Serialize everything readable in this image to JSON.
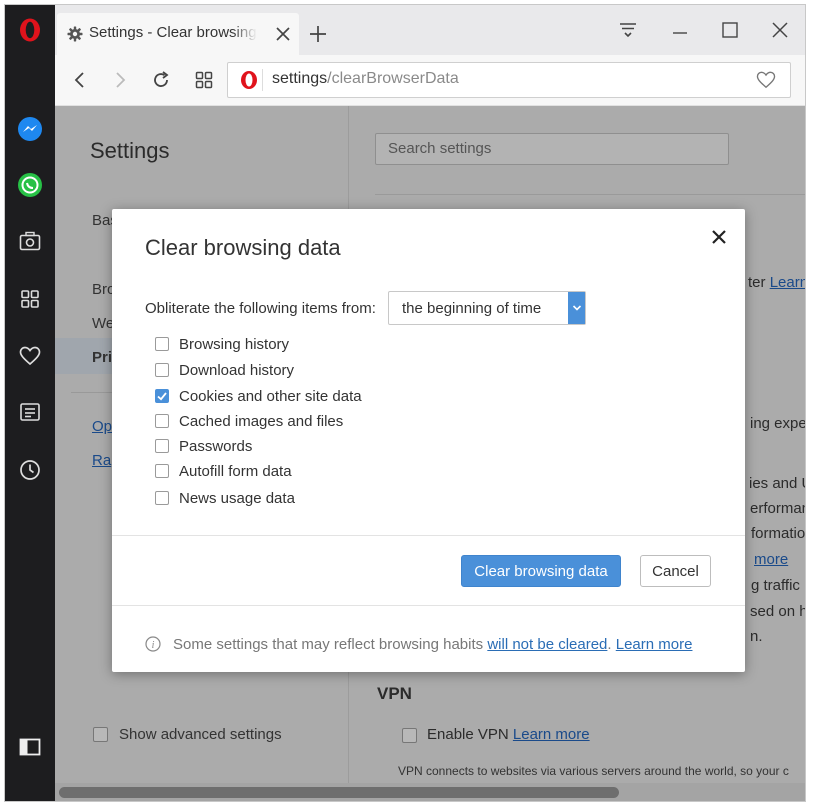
{
  "tab": {
    "title": "Settings - Clear browsing data",
    "close_icon": "close-icon",
    "favicon": "gear-icon"
  },
  "window_controls": {
    "menu_icon": "easy-setup-icon",
    "minimize_icon": "minimize-icon",
    "maximize_icon": "maximize-icon",
    "close_icon": "close-icon"
  },
  "address_bar": {
    "host": "settings",
    "path": "/clearBrowserData"
  },
  "sidebar": {
    "items": [
      {
        "name": "opera-logo-icon"
      },
      {
        "name": "messenger-icon"
      },
      {
        "name": "whatsapp-icon"
      },
      {
        "name": "camera-icon"
      },
      {
        "name": "speed-dial-icon"
      },
      {
        "name": "heart-icon"
      },
      {
        "name": "news-icon"
      },
      {
        "name": "history-clock-icon"
      },
      {
        "name": "sidebar-toggle-icon"
      }
    ]
  },
  "settings_page": {
    "title": "Settings",
    "nav": {
      "basic": "Bas",
      "browser": "Bro",
      "websites": "We",
      "privacy": "Pri",
      "opera_help": "Op",
      "rate": "Ra"
    },
    "search_placeholder": "Search settings",
    "fragments": {
      "f1": "ter",
      "f1_link": "Learn",
      "f2": "ing expe",
      "f3": "ies and U",
      "f4": "erforman",
      "f5": "formatio",
      "f6_link": "more",
      "f7": "g traffic",
      "f8": "sed on h",
      "f9": "n."
    },
    "show_advanced": "Show advanced settings",
    "vpn_heading": "VPN",
    "enable_vpn": "Enable VPN",
    "enable_vpn_link": "Learn more",
    "vpn_desc": "VPN connects to websites via various servers around the world, so your c"
  },
  "dialog": {
    "title": "Clear browsing data",
    "obliterate_label": "Obliterate the following items from:",
    "time_range": "the beginning of time",
    "options": [
      {
        "label": "Browsing history",
        "checked": false
      },
      {
        "label": "Download history",
        "checked": false
      },
      {
        "label": "Cookies and other site data",
        "checked": true
      },
      {
        "label": "Cached images and files",
        "checked": false
      },
      {
        "label": "Passwords",
        "checked": false
      },
      {
        "label": "Autofill form data",
        "checked": false
      },
      {
        "label": "News usage data",
        "checked": false
      }
    ],
    "clear_button": "Clear browsing data",
    "cancel_button": "Cancel",
    "footer_text": "Some settings that may reflect browsing habits",
    "footer_link1": "will not be cleared",
    "footer_period": ".",
    "footer_link2": "Learn more"
  },
  "colors": {
    "accent": "#4a90d9",
    "opera_red": "#e0131c",
    "sidebar_bg": "#1d1d1f"
  }
}
